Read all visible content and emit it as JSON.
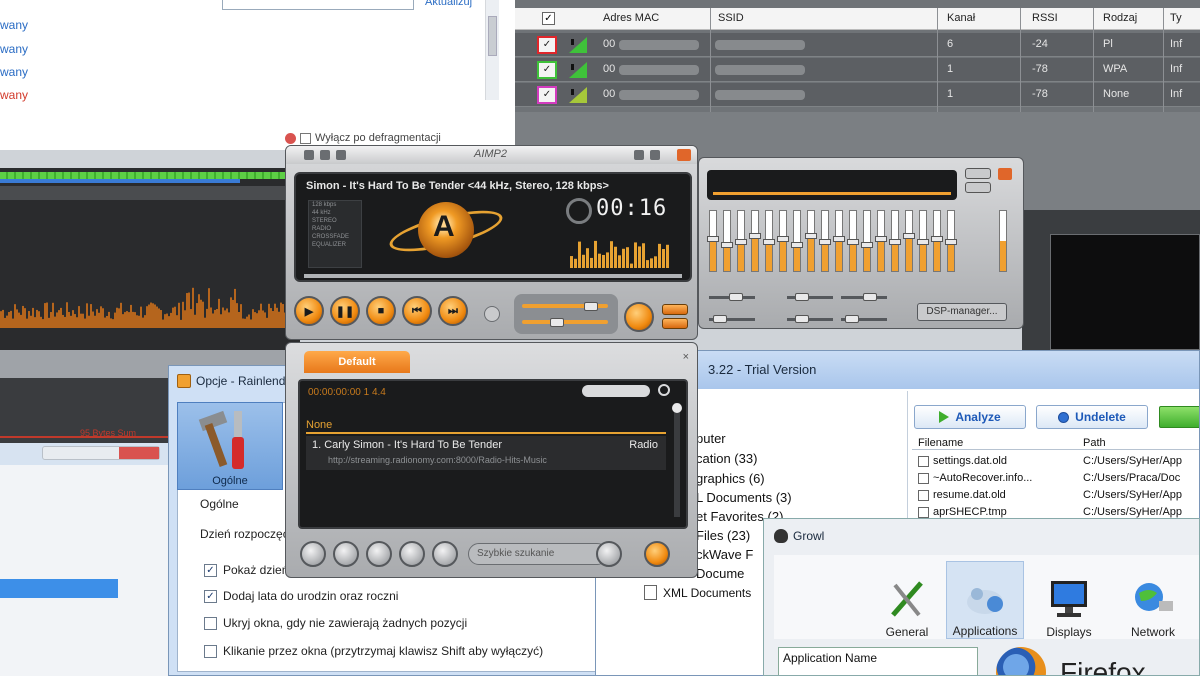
{
  "top_left": {
    "update_label": "Aktualizuj",
    "items": [
      "wany",
      "wany",
      "wany",
      "wany"
    ],
    "defrag_label": "Wyłącz po defragmentacji"
  },
  "wifi": {
    "columns": [
      "Adres MAC",
      "SSID",
      "Kanał",
      "RSSI",
      "Rodzaj",
      "Ty"
    ],
    "rows": [
      {
        "mac": "00",
        "channel": "6",
        "rssi": "-24",
        "type": "Pl",
        "extra": "Inf",
        "color": "#e0262b"
      },
      {
        "mac": "00",
        "channel": "1",
        "rssi": "-78",
        "type": "WPA",
        "extra": "Inf",
        "color": "#3fc23a"
      },
      {
        "mac": "00",
        "channel": "1",
        "rssi": "-78",
        "type": "None",
        "extra": "Inf",
        "color": "#d33bbf"
      }
    ]
  },
  "analyzer": {
    "strip_label": "95 Bytes Sum"
  },
  "aimp": {
    "title": "AIMP2",
    "track": "Simon - It's Hard To Be Tender <44 kHz, Stereo, 128 kbps>",
    "info_lines": [
      "128 kbps",
      "44 kHz",
      "STEREO",
      "RADIO",
      "CROSSFADE",
      "EQUALIZER"
    ],
    "time": "00:16",
    "logo_letter": "A",
    "progress_fraction": 1.0,
    "buttons": [
      "▶",
      "❚❚",
      "■",
      "⏮",
      "⏭"
    ]
  },
  "equalizer": {
    "dsp_label": "DSP-manager..."
  },
  "playlist": {
    "tab": "Default",
    "stat": "00:00:00:00     1     4.4",
    "group": "None",
    "entry_title": "1. Carly Simon - It's Hard To Be Tender",
    "entry_duration": "Radio",
    "entry_url": "http://streaming.radionomy.com:8000/Radio-Hits-Music",
    "search_placeholder": "Szybkie szukanie"
  },
  "opcje": {
    "title": "Opcje - Rainlendar",
    "tab_label": "Ogólne",
    "section": "Ogólne",
    "start_label": "Dzień rozpoczęcia tygodnia",
    "options": [
      {
        "label": "Pokaż dzień",
        "checked": true
      },
      {
        "label": "Dodaj lata do urodzin oraz roczni",
        "checked": true
      },
      {
        "label": "Ukryj okna, gdy nie zawierają żadnych pozycji",
        "checked": false
      },
      {
        "label": "Klikanie przez okna (przytrzymaj klawisz Shift aby wyłączyć)",
        "checked": false
      }
    ]
  },
  "undelete": {
    "title": "3.22 - Trial Version",
    "tree": [
      "puter",
      "cation (33)",
      "graphics (6)",
      "L Documents (3)",
      "et Favorites (2)",
      "Files (23)",
      "ckWave F",
      "Docume"
    ],
    "xml_item": "XML Documents",
    "analyze": "Analyze",
    "undelete": "Undelete",
    "col_filename": "Filename",
    "col_path": "Path",
    "files": [
      {
        "name": "settings.dat.old",
        "path": "C:/Users/SyHer/App"
      },
      {
        "name": "~AutoRecover.info...",
        "path": "C:/Users/Praca/Doc"
      },
      {
        "name": "resume.dat.old",
        "path": "C:/Users/SyHer/App"
      },
      {
        "name": "aprSHECP.tmp",
        "path": "C:/Users/SyHer/App"
      }
    ]
  },
  "growl": {
    "title": "Growl",
    "tools": [
      "General",
      "Applications",
      "Displays",
      "Network"
    ],
    "app_header": "Application Name",
    "firefox_label": "Firefox"
  }
}
